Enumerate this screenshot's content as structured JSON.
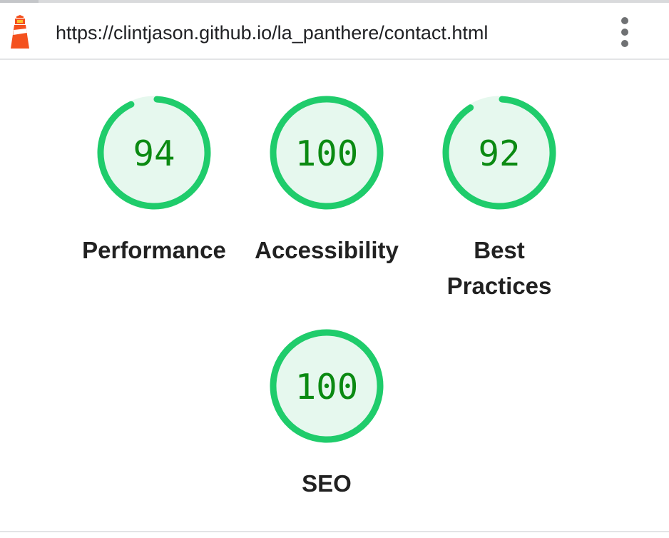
{
  "header": {
    "url": "https://clintjason.github.io/la_panthere/contact.html",
    "logo_icon": "lighthouse-icon",
    "menu_icon": "more-vertical-icon"
  },
  "categories": [
    {
      "name": "performance",
      "score": 94,
      "score_text": "94",
      "label": "Performance"
    },
    {
      "name": "accessibility",
      "score": 100,
      "score_text": "100",
      "label": "Accessibility"
    },
    {
      "name": "best-practices",
      "score": 92,
      "score_text": "92",
      "label": "Best Practices"
    },
    {
      "name": "seo",
      "score": 100,
      "score_text": "100",
      "label": "SEO"
    }
  ],
  "colors": {
    "pass_ring": "#1fcc6b",
    "pass_fill": "#e6f8ee",
    "pass_text": "#0b8a12",
    "track": "#e6f8ee"
  }
}
